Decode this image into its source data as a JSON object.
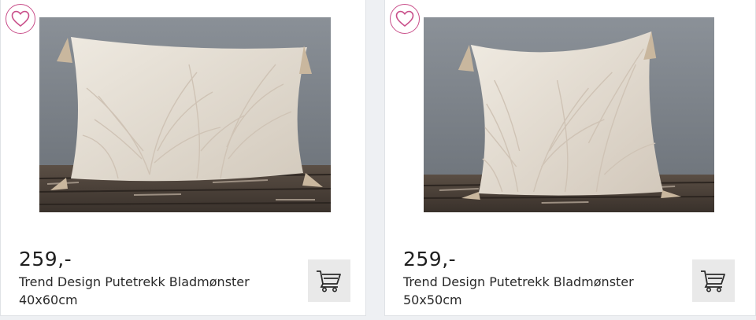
{
  "products": [
    {
      "price": "259,-",
      "title": "Trend Design Putetrekk Bladmønster",
      "size": "40x60cm",
      "image_alt": "Trend Design Putetrekk Bladmønster 40x60cm"
    },
    {
      "price": "259,-",
      "title": "Trend Design Putetrekk Bladmønster",
      "size": "50x50cm",
      "image_alt": "Trend Design Putetrekk Bladmønster 50x50cm"
    }
  ],
  "icons": {
    "wishlist": "heart-icon",
    "cart": "shopping-cart-icon"
  },
  "colors": {
    "wishlist_accent": "#c94f8a",
    "cart_button_bg": "#e9e9e9",
    "page_bg": "#eef0f3",
    "text": "#2a2a2a"
  }
}
